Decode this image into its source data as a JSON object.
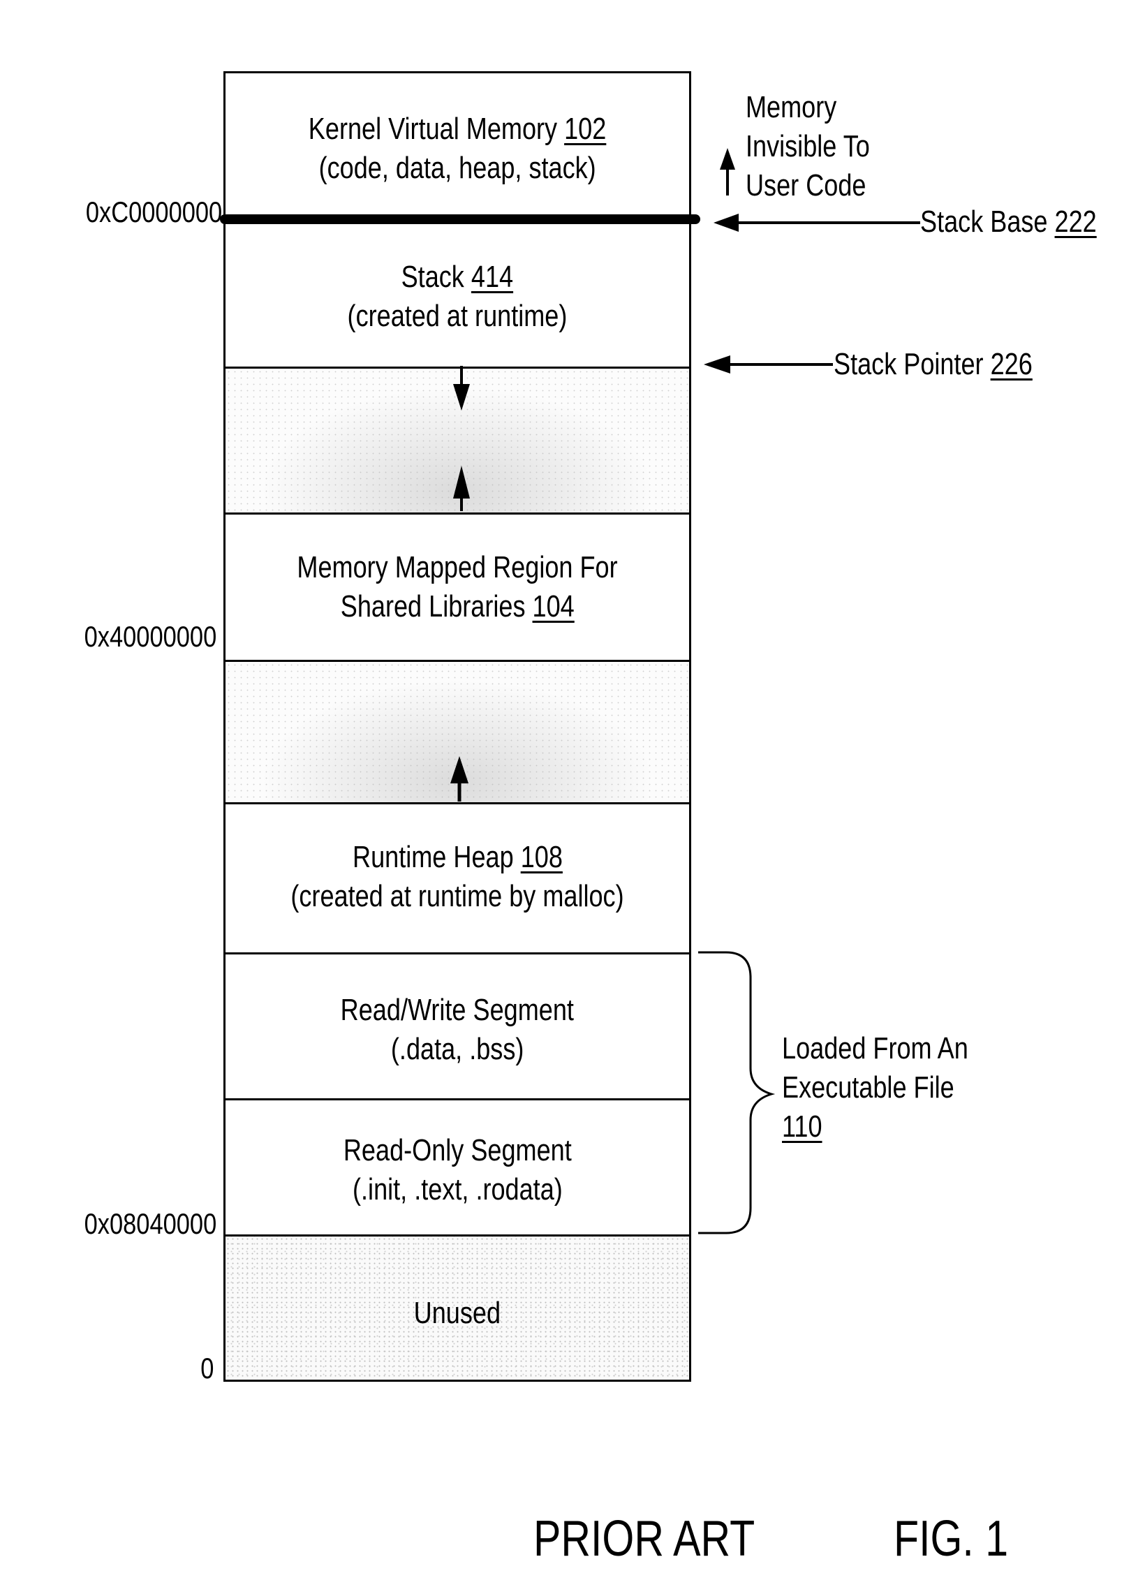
{
  "figure": {
    "footer_left": "PRIOR ART",
    "footer_right": "FIG. 1"
  },
  "segments": [
    {
      "id": "kernel",
      "title": "Kernel Virtual Memory",
      "ref": "102",
      "subtitle": "(code, data, heap, stack)"
    },
    {
      "id": "stack",
      "title": "Stack",
      "ref": "414",
      "subtitle": "(created at runtime)"
    },
    {
      "id": "stack-gap",
      "title": "",
      "ref": "",
      "subtitle": ""
    },
    {
      "id": "mmap",
      "title": "Memory Mapped Region For",
      "ref": "104",
      "subtitle_prefix": "Shared Libraries"
    },
    {
      "id": "heap-gap",
      "title": "",
      "ref": "",
      "subtitle": ""
    },
    {
      "id": "heap",
      "title": "Runtime Heap",
      "ref": "108",
      "subtitle": "(created at runtime by malloc)"
    },
    {
      "id": "rw",
      "title": "Read/Write Segment",
      "ref": "",
      "subtitle": "(.data, .bss)"
    },
    {
      "id": "ro",
      "title": "Read-Only Segment",
      "ref": "",
      "subtitle": "(.init, .text, .rodata)"
    },
    {
      "id": "unused",
      "title": "Unused",
      "ref": "",
      "subtitle": ""
    }
  ],
  "addresses": [
    {
      "label": "0xC0000000"
    },
    {
      "label": "0x40000000"
    },
    {
      "label": "0x08040000"
    },
    {
      "label": "0"
    }
  ],
  "annotations": {
    "invisible_memory": [
      "Memory",
      "Invisible To",
      "User Code"
    ],
    "stack_base": {
      "label": "Stack Base",
      "ref": "222"
    },
    "stack_pointer": {
      "label": "Stack Pointer",
      "ref": "226"
    },
    "executable": {
      "lines": [
        "Loaded From An",
        "Executable File"
      ],
      "ref": "110"
    }
  }
}
